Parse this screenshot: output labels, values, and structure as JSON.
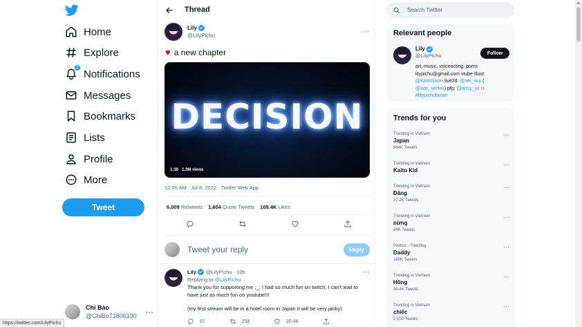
{
  "nav": {
    "items": [
      {
        "label": "Home",
        "icon": "home-icon"
      },
      {
        "label": "Explore",
        "icon": "hashtag-icon"
      },
      {
        "label": "Notifications",
        "icon": "bell-icon",
        "badge": "2"
      },
      {
        "label": "Messages",
        "icon": "envelope-icon"
      },
      {
        "label": "Bookmarks",
        "icon": "bookmark-icon"
      },
      {
        "label": "Lists",
        "icon": "list-icon"
      },
      {
        "label": "Profile",
        "icon": "person-icon"
      },
      {
        "label": "More",
        "icon": "more-circle-icon"
      }
    ],
    "tweet_button": "Tweet",
    "account": {
      "name": "Chi Bảo",
      "handle": "@ChiBo71806190"
    },
    "status_url": "https://twitter.com/LilyPichu"
  },
  "main": {
    "title": "Thread",
    "tweet": {
      "author_name": "Lily",
      "author_handle": "@LilyPichu",
      "text": "a new chapter",
      "media_word": "DECISION",
      "media_duration": "1:30",
      "media_views": "1.3M views",
      "timestamp": "12:00 AM · Jul 8, 2022 · Twitter Web App",
      "retweets_count": "6,009",
      "retweets_label": "Retweets",
      "quotes_count": "1,604",
      "quotes_label": "Quote Tweets",
      "likes_count": "109.4K",
      "likes_label": "Likes"
    },
    "reply_placeholder": "Tweet your reply",
    "reply_button": "Reply",
    "reply_tweet": {
      "author_name": "Lily",
      "author_handle": "@LilyPichu · 10h",
      "replying_prefix": "Replying to",
      "replying_to": "@LilyPichu",
      "text1": "Thank you for supporting me ;_; I had so much fun on twitch, I can't wait to have just as much fun on youtube!!!",
      "text2": "(my first stream will be in a hotel room in Japan it will be very janky)",
      "replies": "67",
      "retweets": "258",
      "likes": "20.4K"
    }
  },
  "right": {
    "search_placeholder": "Search Twitter",
    "relevant_title": "Relevant people",
    "person": {
      "name": "Lily",
      "handle": "@LilyPichu",
      "follow": "Follow",
      "bio_line1": "art, music, voiceacting, poms",
      "bio_line2": "lilypichu@gmail.com vtube illust:",
      "bio_link1": "@KrissSison",
      "bio_mid1": " live2d: ",
      "bio_link2": "@sei_soy",
      "bio_mid2": " (",
      "bio_link3": "@iron_vertex",
      "bio_mid3": ") pfp: ",
      "bio_link4": "@artsy_vii",
      "bio_link5": "#lilypichufanart"
    },
    "trends_title": "Trends for you",
    "trends": [
      {
        "meta": "Trending in Vietnam",
        "name": "Japan",
        "count": "664K Tweets"
      },
      {
        "meta": "Trending in Vietnam",
        "name": "Kaito Kid",
        "count": ""
      },
      {
        "meta": "Trending in Vietnam",
        "name": "Đăng",
        "count": "27.2K Tweets"
      },
      {
        "meta": "Trending in Vietnam",
        "name": "nừng",
        "count": "34K Tweets"
      },
      {
        "meta": "Politics · Trending",
        "name": "Daddy",
        "count": "190K Tweets"
      },
      {
        "meta": "Trending in Vietnam",
        "name": "Hồng",
        "count": "36.4K Tweets"
      },
      {
        "meta": "Trending in Vietnam",
        "name": "chiếc",
        "count": "2,100 Tweets"
      }
    ]
  },
  "colors": {
    "accent": "#1d9bf0",
    "text": "#0f1419",
    "muted": "#536471"
  }
}
